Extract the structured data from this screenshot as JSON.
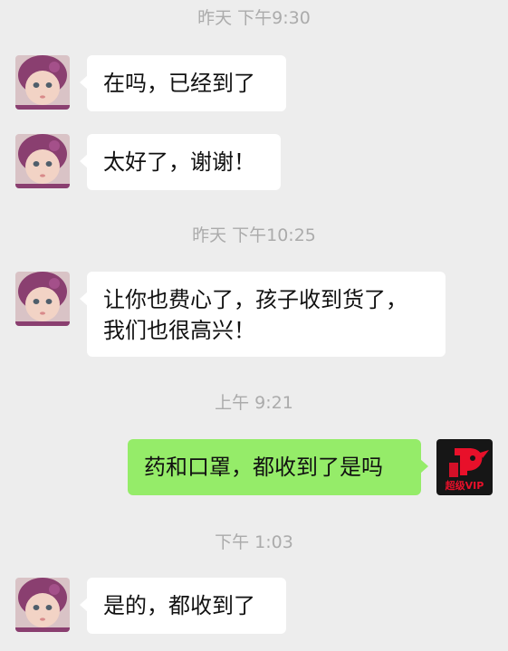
{
  "chat": {
    "messages": [
      {
        "type": "timestamp",
        "text": "昨天 下午9:30"
      },
      {
        "type": "incoming",
        "lines": [
          "在吗，已经到了"
        ]
      },
      {
        "type": "incoming",
        "lines": [
          "太好了，谢谢！"
        ]
      },
      {
        "type": "timestamp",
        "text": "昨天 下午10:25"
      },
      {
        "type": "incoming",
        "lines": [
          "让你也费心了，孩子收到货了，",
          "我们也很高兴！"
        ]
      },
      {
        "type": "timestamp",
        "text": "上午 9:21"
      },
      {
        "type": "outgoing",
        "lines": [
          "药和口罩，都收到了是吗"
        ]
      },
      {
        "type": "timestamp",
        "text": "下午 1:03"
      },
      {
        "type": "incoming",
        "lines": [
          "是的，都收到了"
        ]
      }
    ],
    "self_avatar": {
      "icon": "super-vip-logo",
      "label": "超级VIP"
    }
  },
  "colors": {
    "background": "#ededed",
    "incoming_bubble": "#ffffff",
    "outgoing_bubble": "#95ec69",
    "timestamp": "#ababab",
    "vip_red": "#e8102a"
  }
}
